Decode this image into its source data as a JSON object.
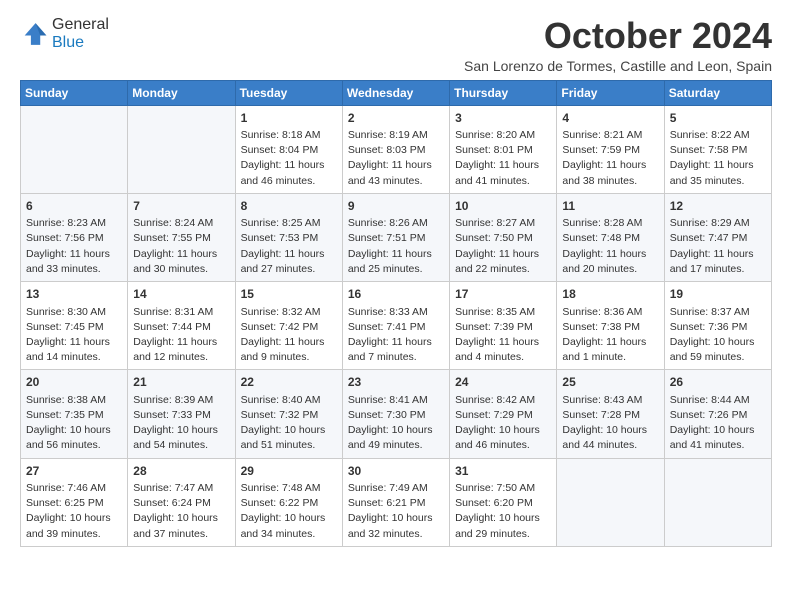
{
  "header": {
    "logo_general": "General",
    "logo_blue": "Blue",
    "month_title": "October 2024",
    "subtitle": "San Lorenzo de Tormes, Castille and Leon, Spain"
  },
  "columns": [
    "Sunday",
    "Monday",
    "Tuesday",
    "Wednesday",
    "Thursday",
    "Friday",
    "Saturday"
  ],
  "weeks": [
    [
      {
        "day": "",
        "text": ""
      },
      {
        "day": "",
        "text": ""
      },
      {
        "day": "1",
        "text": "Sunrise: 8:18 AM\nSunset: 8:04 PM\nDaylight: 11 hours and 46 minutes."
      },
      {
        "day": "2",
        "text": "Sunrise: 8:19 AM\nSunset: 8:03 PM\nDaylight: 11 hours and 43 minutes."
      },
      {
        "day": "3",
        "text": "Sunrise: 8:20 AM\nSunset: 8:01 PM\nDaylight: 11 hours and 41 minutes."
      },
      {
        "day": "4",
        "text": "Sunrise: 8:21 AM\nSunset: 7:59 PM\nDaylight: 11 hours and 38 minutes."
      },
      {
        "day": "5",
        "text": "Sunrise: 8:22 AM\nSunset: 7:58 PM\nDaylight: 11 hours and 35 minutes."
      }
    ],
    [
      {
        "day": "6",
        "text": "Sunrise: 8:23 AM\nSunset: 7:56 PM\nDaylight: 11 hours and 33 minutes."
      },
      {
        "day": "7",
        "text": "Sunrise: 8:24 AM\nSunset: 7:55 PM\nDaylight: 11 hours and 30 minutes."
      },
      {
        "day": "8",
        "text": "Sunrise: 8:25 AM\nSunset: 7:53 PM\nDaylight: 11 hours and 27 minutes."
      },
      {
        "day": "9",
        "text": "Sunrise: 8:26 AM\nSunset: 7:51 PM\nDaylight: 11 hours and 25 minutes."
      },
      {
        "day": "10",
        "text": "Sunrise: 8:27 AM\nSunset: 7:50 PM\nDaylight: 11 hours and 22 minutes."
      },
      {
        "day": "11",
        "text": "Sunrise: 8:28 AM\nSunset: 7:48 PM\nDaylight: 11 hours and 20 minutes."
      },
      {
        "day": "12",
        "text": "Sunrise: 8:29 AM\nSunset: 7:47 PM\nDaylight: 11 hours and 17 minutes."
      }
    ],
    [
      {
        "day": "13",
        "text": "Sunrise: 8:30 AM\nSunset: 7:45 PM\nDaylight: 11 hours and 14 minutes."
      },
      {
        "day": "14",
        "text": "Sunrise: 8:31 AM\nSunset: 7:44 PM\nDaylight: 11 hours and 12 minutes."
      },
      {
        "day": "15",
        "text": "Sunrise: 8:32 AM\nSunset: 7:42 PM\nDaylight: 11 hours and 9 minutes."
      },
      {
        "day": "16",
        "text": "Sunrise: 8:33 AM\nSunset: 7:41 PM\nDaylight: 11 hours and 7 minutes."
      },
      {
        "day": "17",
        "text": "Sunrise: 8:35 AM\nSunset: 7:39 PM\nDaylight: 11 hours and 4 minutes."
      },
      {
        "day": "18",
        "text": "Sunrise: 8:36 AM\nSunset: 7:38 PM\nDaylight: 11 hours and 1 minute."
      },
      {
        "day": "19",
        "text": "Sunrise: 8:37 AM\nSunset: 7:36 PM\nDaylight: 10 hours and 59 minutes."
      }
    ],
    [
      {
        "day": "20",
        "text": "Sunrise: 8:38 AM\nSunset: 7:35 PM\nDaylight: 10 hours and 56 minutes."
      },
      {
        "day": "21",
        "text": "Sunrise: 8:39 AM\nSunset: 7:33 PM\nDaylight: 10 hours and 54 minutes."
      },
      {
        "day": "22",
        "text": "Sunrise: 8:40 AM\nSunset: 7:32 PM\nDaylight: 10 hours and 51 minutes."
      },
      {
        "day": "23",
        "text": "Sunrise: 8:41 AM\nSunset: 7:30 PM\nDaylight: 10 hours and 49 minutes."
      },
      {
        "day": "24",
        "text": "Sunrise: 8:42 AM\nSunset: 7:29 PM\nDaylight: 10 hours and 46 minutes."
      },
      {
        "day": "25",
        "text": "Sunrise: 8:43 AM\nSunset: 7:28 PM\nDaylight: 10 hours and 44 minutes."
      },
      {
        "day": "26",
        "text": "Sunrise: 8:44 AM\nSunset: 7:26 PM\nDaylight: 10 hours and 41 minutes."
      }
    ],
    [
      {
        "day": "27",
        "text": "Sunrise: 7:46 AM\nSunset: 6:25 PM\nDaylight: 10 hours and 39 minutes."
      },
      {
        "day": "28",
        "text": "Sunrise: 7:47 AM\nSunset: 6:24 PM\nDaylight: 10 hours and 37 minutes."
      },
      {
        "day": "29",
        "text": "Sunrise: 7:48 AM\nSunset: 6:22 PM\nDaylight: 10 hours and 34 minutes."
      },
      {
        "day": "30",
        "text": "Sunrise: 7:49 AM\nSunset: 6:21 PM\nDaylight: 10 hours and 32 minutes."
      },
      {
        "day": "31",
        "text": "Sunrise: 7:50 AM\nSunset: 6:20 PM\nDaylight: 10 hours and 29 minutes."
      },
      {
        "day": "",
        "text": ""
      },
      {
        "day": "",
        "text": ""
      }
    ]
  ]
}
